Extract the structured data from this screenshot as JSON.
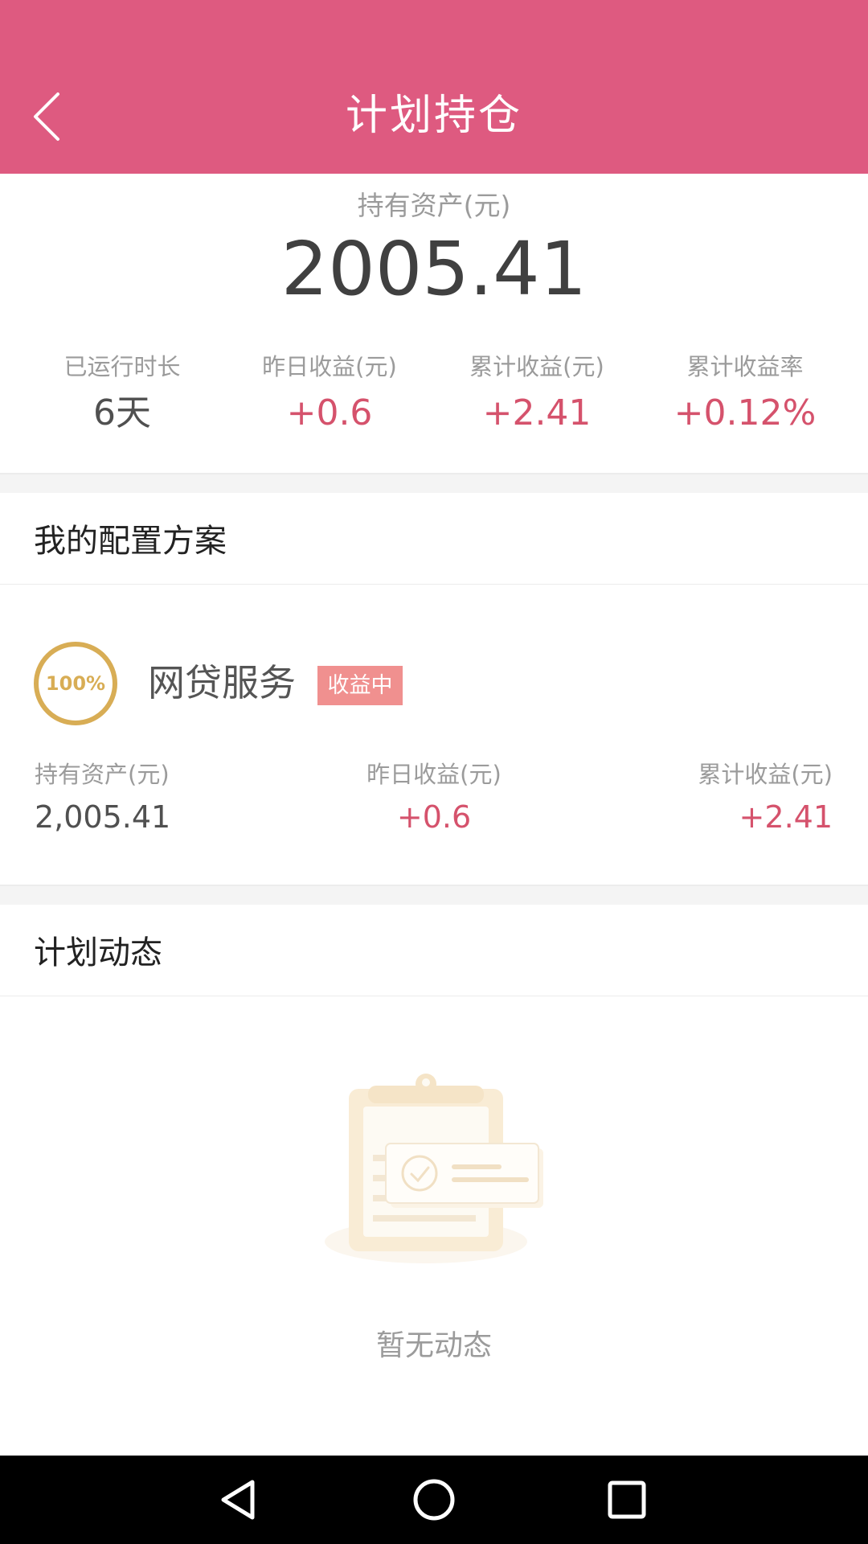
{
  "header": {
    "title": "计划持仓"
  },
  "summary": {
    "asset_label": "持有资产(元)",
    "asset_value": "2005.41",
    "stats": [
      {
        "label": "已运行时长",
        "value": "6天"
      },
      {
        "label": "昨日收益(元)",
        "value": "+0.6"
      },
      {
        "label": "累计收益(元)",
        "value": "+2.41"
      },
      {
        "label": "累计收益率",
        "value": "+0.12%"
      }
    ]
  },
  "allocation": {
    "title": "我的配置方案",
    "plan": {
      "percent": "100%",
      "name": "网贷服务",
      "status": "收益中",
      "columns": [
        {
          "label": "持有资产(元)",
          "value": "2,005.41"
        },
        {
          "label": "昨日收益(元)",
          "value": "+0.6"
        },
        {
          "label": "累计收益(元)",
          "value": "+2.41"
        }
      ]
    }
  },
  "activity": {
    "title": "计划动态",
    "empty_text": "暂无动态"
  },
  "colors": {
    "header_bg": "#de5a80",
    "profit_red": "#d5526c",
    "ring_gold": "#d8ad55",
    "badge_bg": "#f0908f"
  },
  "icons": [
    "back-chevron-icon",
    "empty-clipboard-icon",
    "nav-back-icon",
    "nav-home-icon",
    "nav-recents-icon"
  ]
}
